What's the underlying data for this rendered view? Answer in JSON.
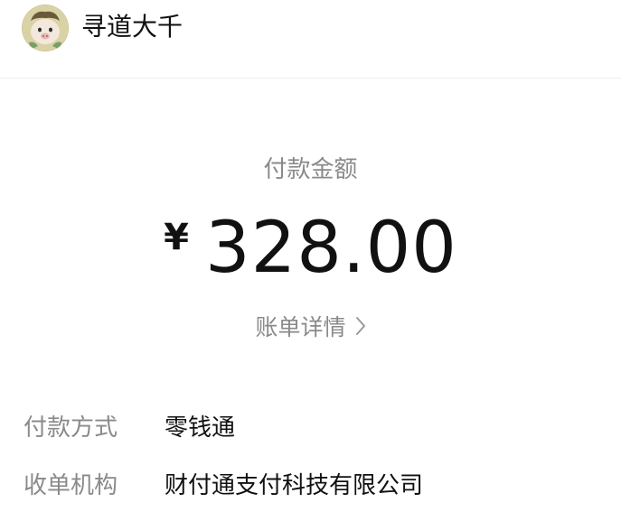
{
  "header": {
    "avatar_icon": "cartoon-pig-avatar-icon",
    "merchant_name": "寻道大千"
  },
  "payment": {
    "amount_label": "付款金额",
    "currency_symbol": "¥",
    "amount": "328.00",
    "detail_link": "账单详情",
    "detail_icon": "chevron-right-icon"
  },
  "details": [
    {
      "key": "付款方式",
      "value": "零钱通"
    },
    {
      "key": "收单机构",
      "value": "财付通支付科技有限公司"
    }
  ],
  "colors": {
    "primary_text": "#111111",
    "secondary_text": "#8a8a8a",
    "divider": "#ececec",
    "background": "#ffffff"
  }
}
